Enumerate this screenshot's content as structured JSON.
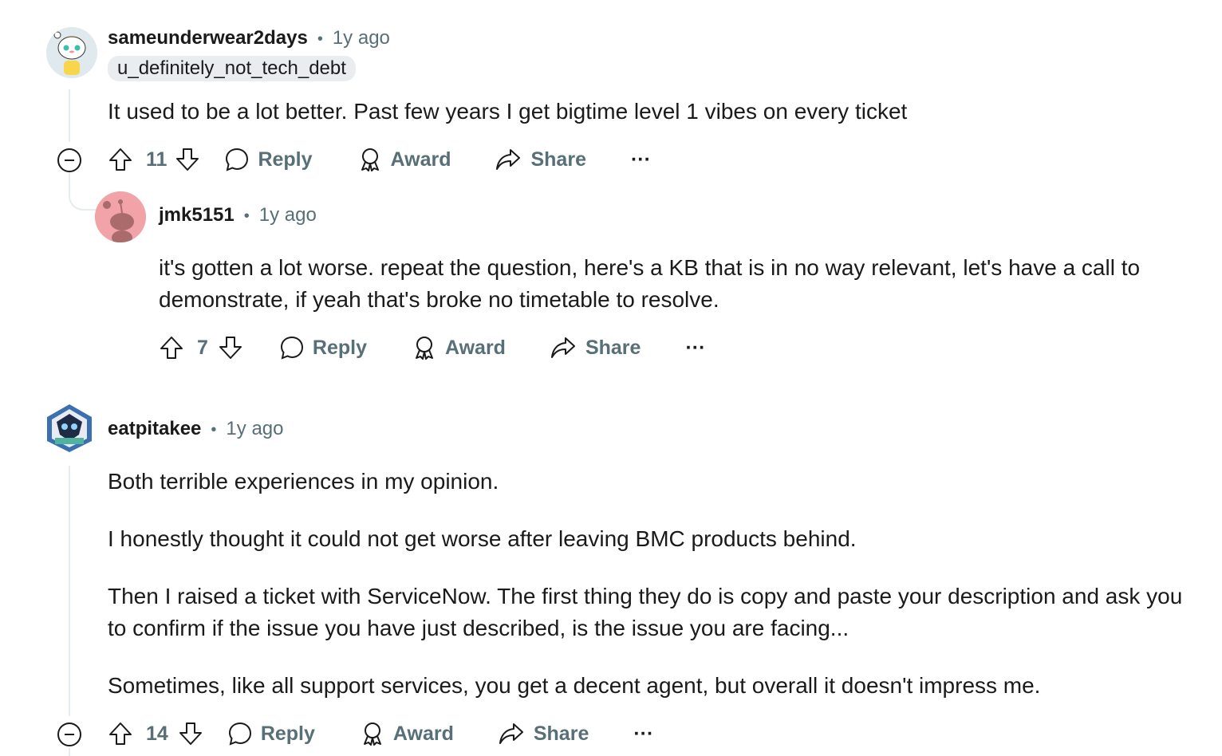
{
  "comments": [
    {
      "username": "sameunderwear2days",
      "time": "1y ago",
      "flair": "u_definitely_not_tech_debt",
      "paragraphs": [
        "It used to be a lot better. Past few years I get bigtime level 1 vibes on every ticket"
      ],
      "votes": "11",
      "reply_label": "Reply",
      "award_label": "Award",
      "share_label": "Share",
      "more_label": "···"
    },
    {
      "username": "jmk5151",
      "time": "1y ago",
      "paragraphs": [
        "it's gotten a lot worse. repeat the question, here's a KB that is in no way relevant, let's have a call to demonstrate, if yeah that's broke no timetable to resolve."
      ],
      "votes": "7",
      "reply_label": "Reply",
      "award_label": "Award",
      "share_label": "Share",
      "more_label": "···"
    },
    {
      "username": "eatpitakee",
      "time": "1y ago",
      "paragraphs": [
        "Both terrible experiences in my opinion.",
        "I honestly thought it could not get worse after leaving BMC products behind.",
        "Then I raised a ticket with ServiceNow. The first thing they do is copy and paste your description and ask you to confirm if the issue you have just described, is the issue you are facing...",
        "Sometimes, like all support services, you get a decent agent, but overall it doesn't impress me."
      ],
      "votes": "14",
      "reply_label": "Reply",
      "award_label": "Award",
      "share_label": "Share",
      "more_label": "···"
    }
  ],
  "separator": "•",
  "colors": {
    "text": "#1a1a1b",
    "meta": "#576f76",
    "thread": "#e5ebee",
    "flair_bg": "#eaedef",
    "snoo_bg": "#f2a3a8"
  }
}
